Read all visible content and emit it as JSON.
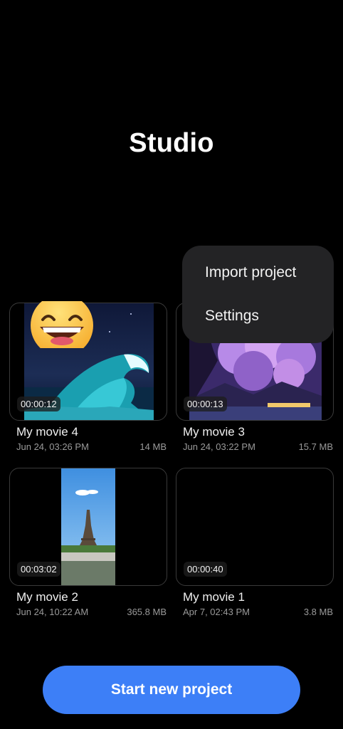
{
  "header": {
    "title": "Studio"
  },
  "menu": {
    "items": [
      {
        "label": "Import project"
      },
      {
        "label": "Settings"
      }
    ]
  },
  "projects": [
    {
      "name": "My movie 4",
      "date": "Jun 24, 03:26 PM",
      "size": "14 MB",
      "duration": "00:00:12",
      "thumbnail": "wave-image"
    },
    {
      "name": "My movie 3",
      "date": "Jun 24, 03:22 PM",
      "size": "15.7 MB",
      "duration": "00:00:13",
      "thumbnail": "purple-clouds-image"
    },
    {
      "name": "My movie 2",
      "date": "Jun 24, 10:22 AM",
      "size": "365.8 MB",
      "duration": "00:03:02",
      "thumbnail": "eiffel-tower-image"
    },
    {
      "name": "My movie 1",
      "date": "Apr 7, 02:43 PM",
      "size": "3.8 MB",
      "duration": "00:00:40",
      "thumbnail": "none"
    }
  ],
  "footer": {
    "start_label": "Start new project"
  },
  "colors": {
    "background": "#000000",
    "accent": "#3d7ff7",
    "popup": "#232325"
  }
}
